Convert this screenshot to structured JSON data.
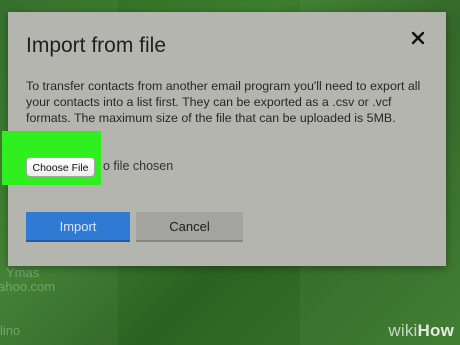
{
  "background": {
    "text_lines": [
      "Ymas",
      "ahoo.com",
      "lino"
    ]
  },
  "dialog": {
    "title": "Import from file",
    "description": "To transfer contacts from another email program you'll need to export all your contacts into a list first. They can be exported as a .csv or .vcf formats. The maximum size of the file that can be uploaded is 5MB.",
    "close_icon": "close-icon",
    "choose_file_label": "Choose File",
    "no_file_text": "o file chosen",
    "import_label": "Import",
    "cancel_label": "Cancel"
  },
  "watermark": {
    "wiki": "wiki",
    "how": "How"
  },
  "colors": {
    "dialog_bg": "#b5b5b0",
    "import_bg": "#2f7bd4",
    "cancel_bg": "#a3a3a0",
    "highlight": "#2ff01e",
    "page_bg": "#3d7e2e"
  }
}
